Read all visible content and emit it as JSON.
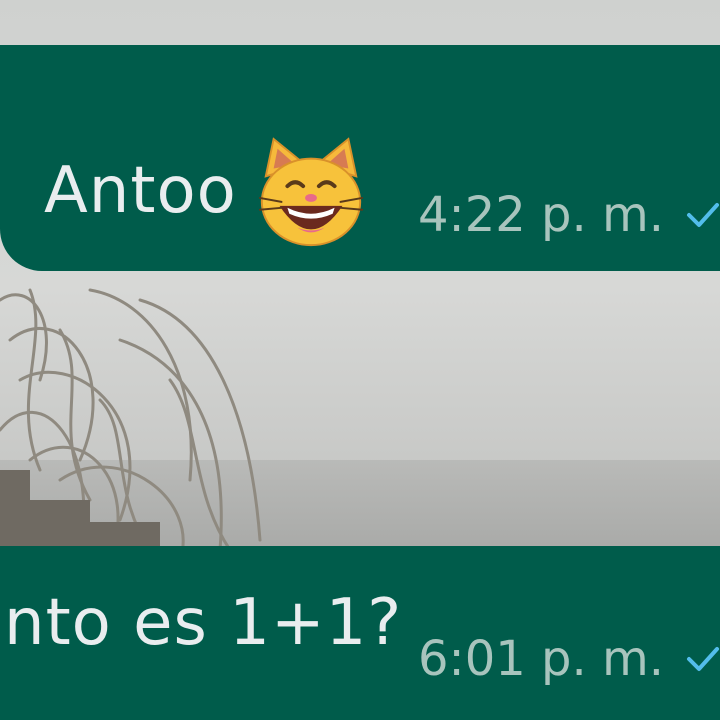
{
  "chat": {
    "messages": [
      {
        "text": "Antoo",
        "emoji": "smiling-cat-face-with-open-mouth",
        "time": "4:22 p. m.",
        "status_icon": "check-icon"
      },
      {
        "text": "nto es 1+1?",
        "time": "6:01 p. m.",
        "status_icon": "check-icon"
      }
    ]
  },
  "colors": {
    "bubble": "#005c4b",
    "text": "#e9edef",
    "meta": "#a8c4bd",
    "check": "#53bdeb"
  }
}
